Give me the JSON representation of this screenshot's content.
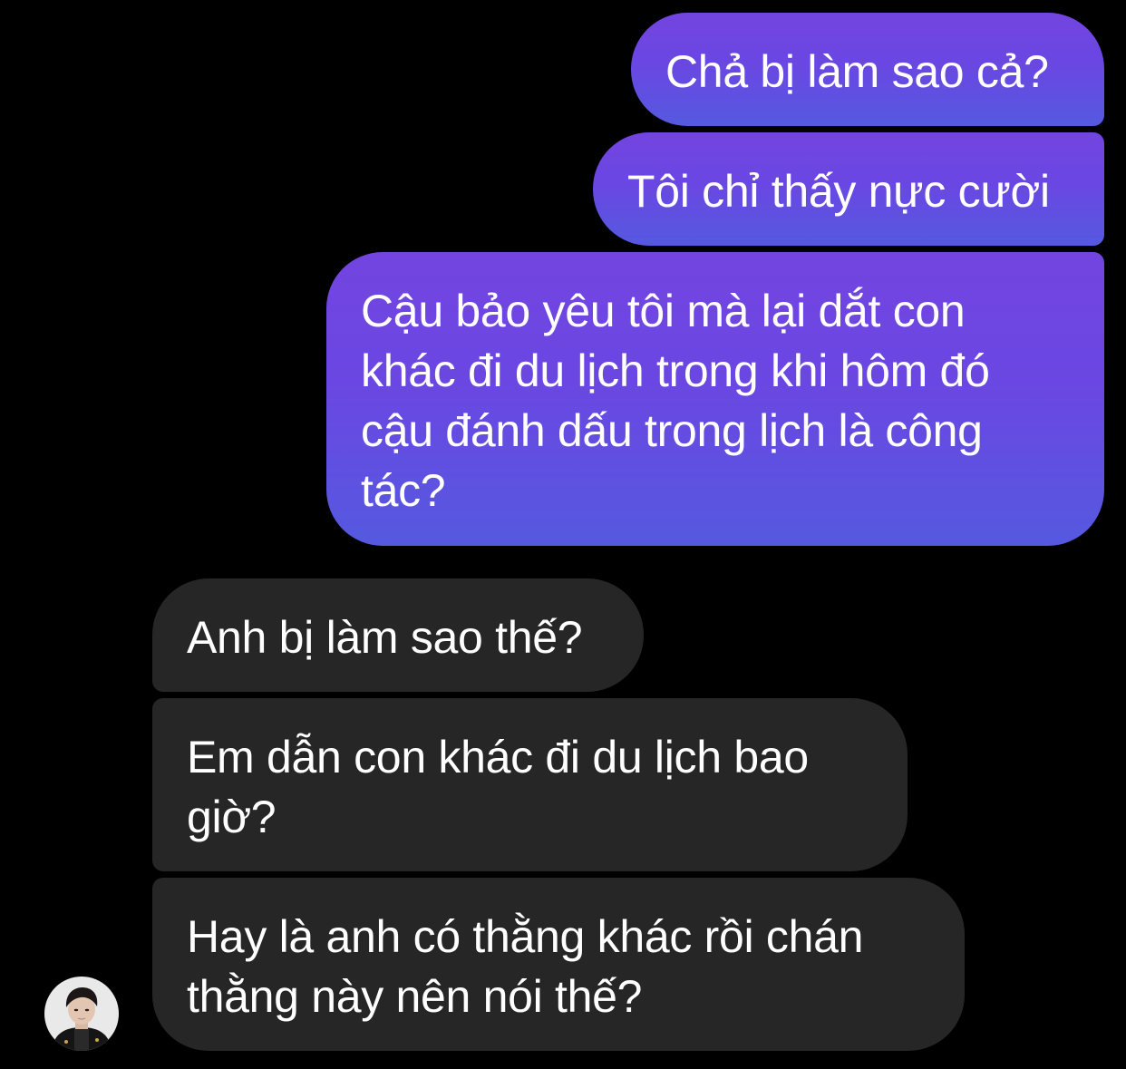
{
  "conversation": {
    "messages": [
      {
        "sender": "me",
        "text": "Chả bị làm sao cả?"
      },
      {
        "sender": "me",
        "text": "Tôi chỉ thấy nực cười"
      },
      {
        "sender": "me",
        "text": "Cậu bảo yêu tôi mà lại dắt con khác đi du lịch trong khi hôm đó cậu đánh dấu trong lịch là công tác?"
      },
      {
        "sender": "other",
        "text": "Anh bị làm sao thế?"
      },
      {
        "sender": "other",
        "text": "Em dẫn con khác đi du lịch bao giờ?"
      },
      {
        "sender": "other",
        "text": "Hay là anh có thằng khác rồi chán thằng này nên nói thế?"
      }
    ]
  },
  "colors": {
    "background": "#000000",
    "sent_bubble_top": "#7344e0",
    "sent_bubble_bottom": "#5559e0",
    "received_bubble": "#262626",
    "text": "#ffffff"
  },
  "icons": {
    "contact_avatar": "profile-photo-avatar"
  }
}
